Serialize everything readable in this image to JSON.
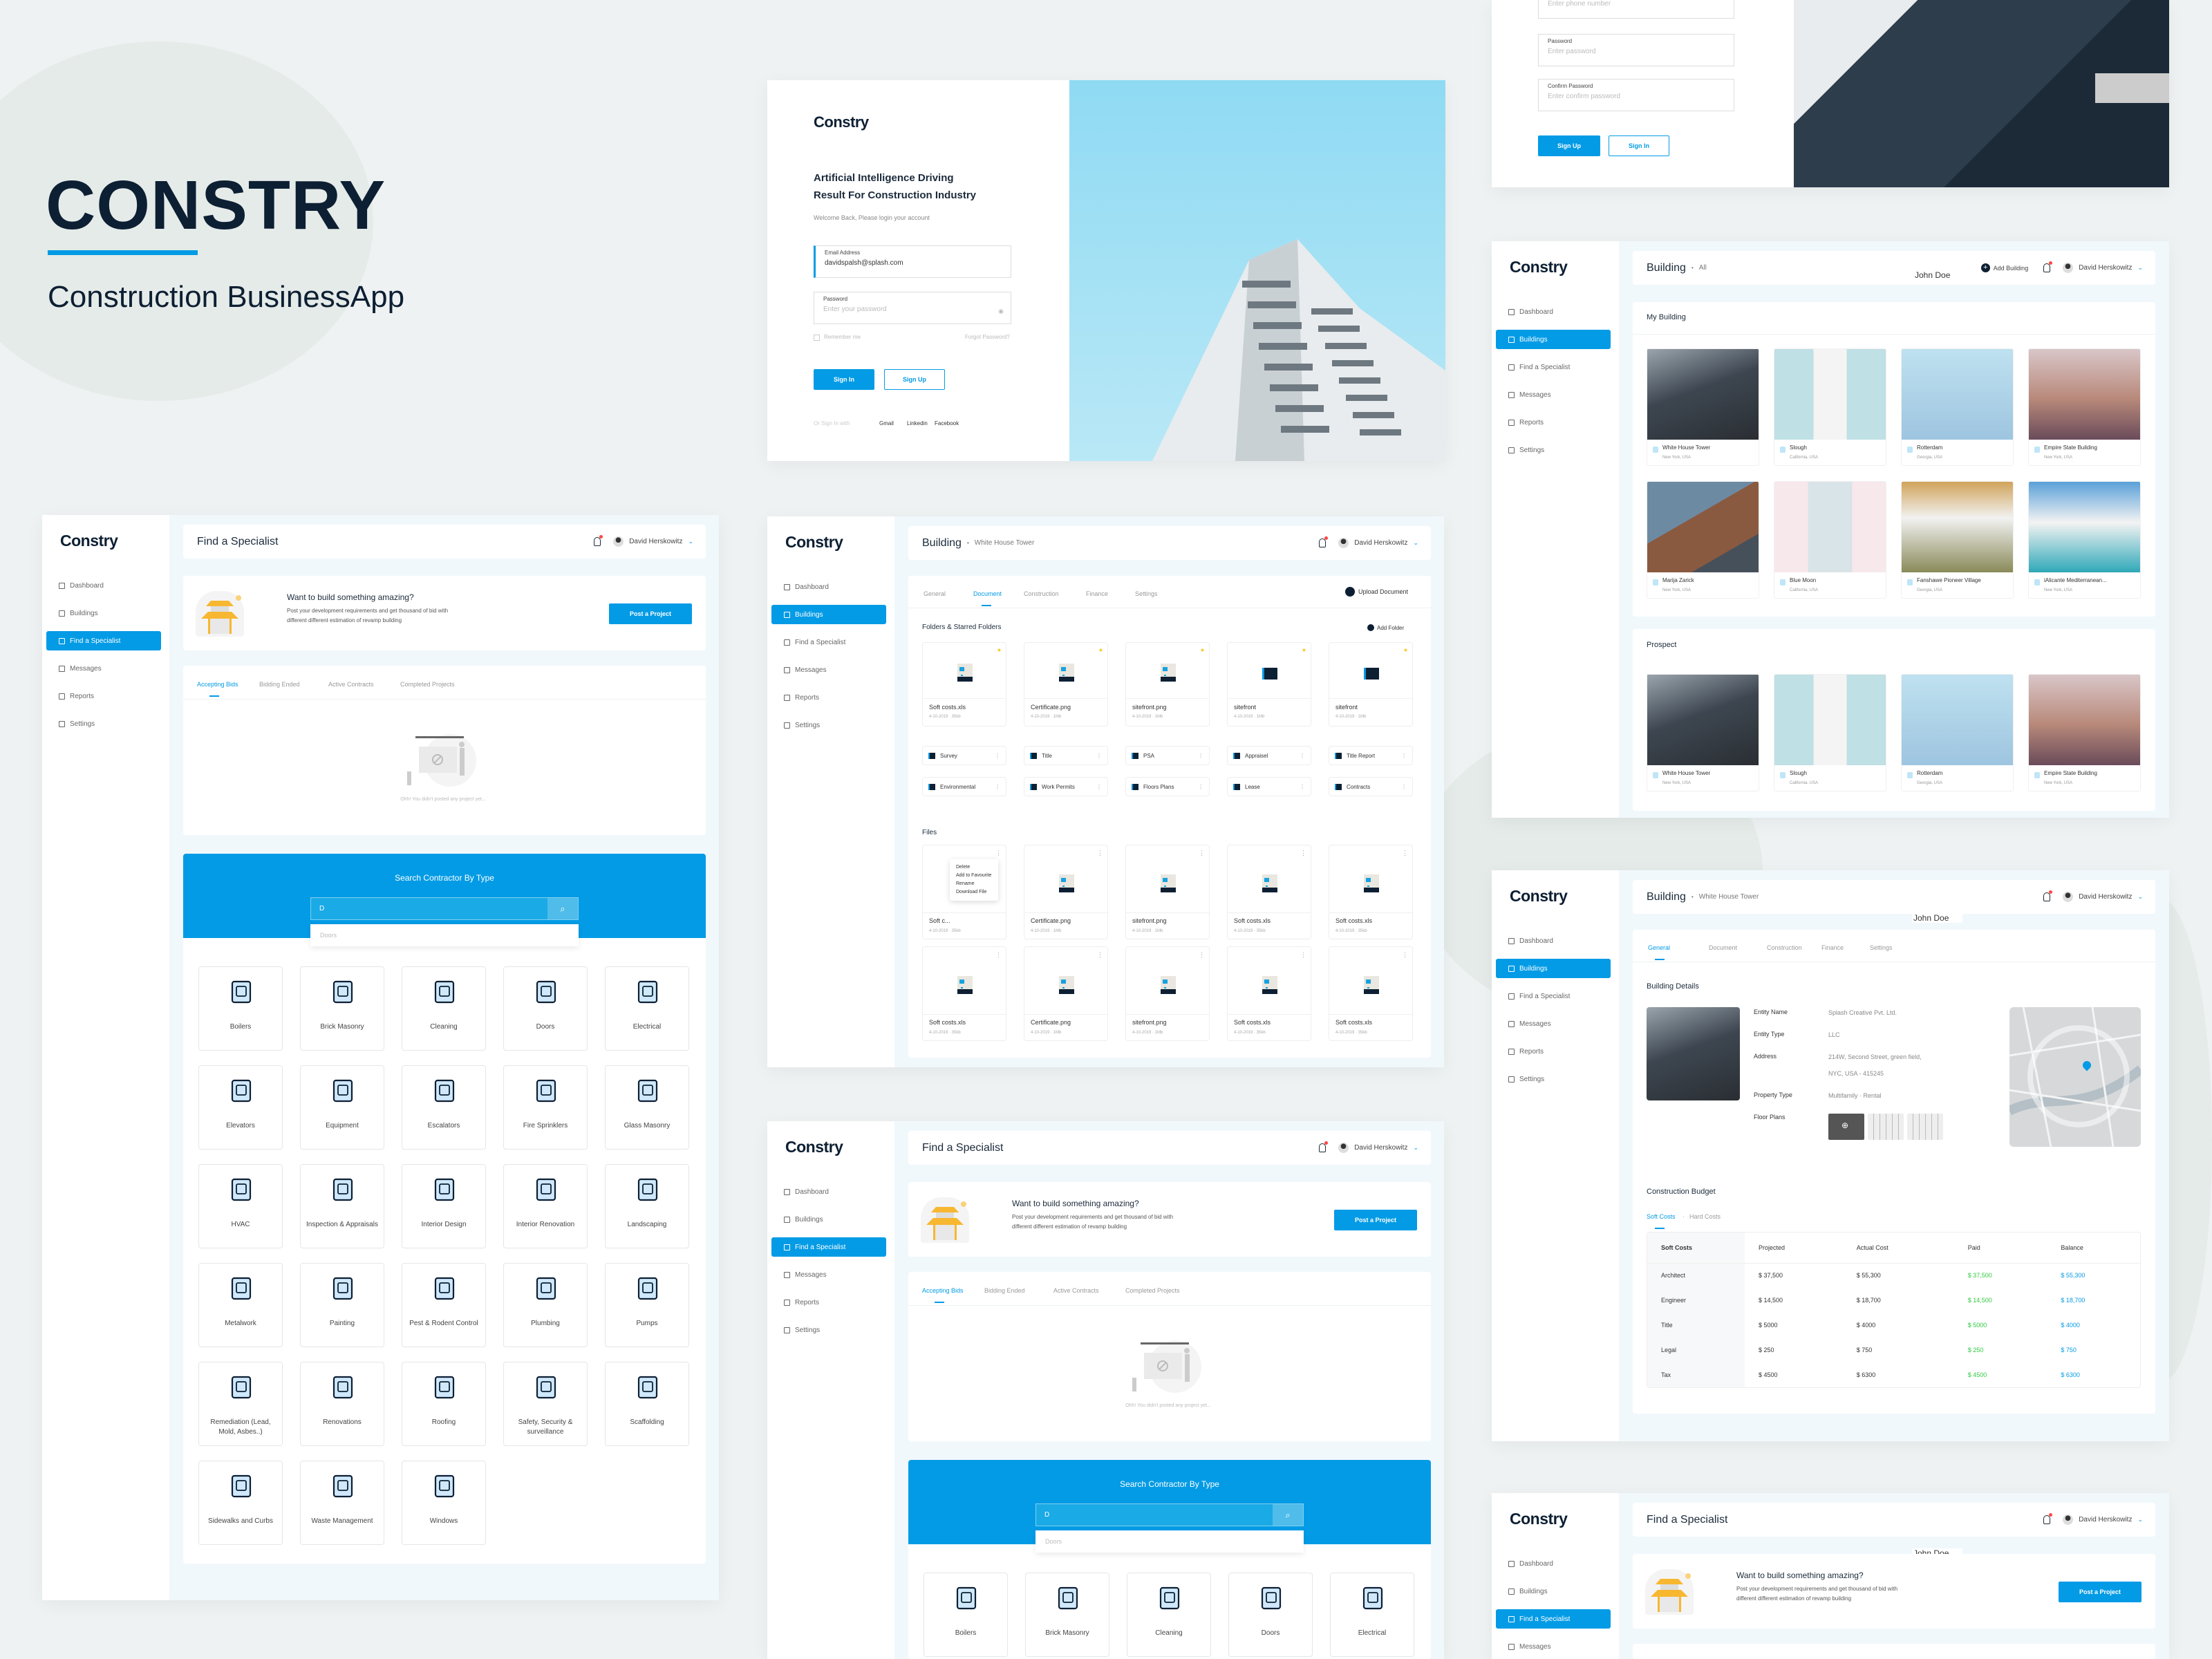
{
  "hero": {
    "title": "CONSTRY",
    "subtitle": "Construction BusinessApp"
  },
  "brand": {
    "logo": "Constry",
    "accent": "#039be5",
    "navy": "#0d1f33"
  },
  "nav": [
    {
      "label": "Dashboard",
      "icon": "dashboard-icon"
    },
    {
      "label": "Buildings",
      "icon": "building-icon"
    },
    {
      "label": "Find a Specialist",
      "icon": "specialist-icon"
    },
    {
      "label": "Messages",
      "icon": "message-icon"
    },
    {
      "label": "Reports",
      "icon": "report-icon"
    },
    {
      "label": "Settings",
      "icon": "gear-icon"
    }
  ],
  "user": {
    "name": "David Herskowitz"
  },
  "overlay_text": "John Doe",
  "login": {
    "headline_1": "Artificial Intelligence Driving",
    "headline_2": "Result For Construction Industry",
    "welcome": "Welcome Back, Please login your account",
    "email_label": "Email Address",
    "email_value": "davidspalsh@splash.com",
    "password_label": "Password",
    "password_placeholder": "Enter your password",
    "remember": "Remember me",
    "forgot": "Forgot Password?",
    "sign_in": "Sign In",
    "sign_up": "Sign Up",
    "or_sign_in_with": "Or Sign In with",
    "social": [
      "Gmail",
      "Linkedin",
      "Facebook"
    ]
  },
  "signup": {
    "phone_placeholder": "Enter phone number",
    "password_label": "Password",
    "password_placeholder": "Enter password",
    "confirm_label": "Confirm Password",
    "confirm_placeholder": "Enter confirm password",
    "sign_up": "Sign Up",
    "sign_in": "Sign In"
  },
  "buildings": {
    "title": "Building",
    "breadcrumb": "All",
    "add_building": "Add Building",
    "my_building_title": "My Building",
    "my_building": [
      {
        "name": "White House Tower",
        "location": "New York, USA"
      },
      {
        "name": "Slough",
        "location": "California, USA"
      },
      {
        "name": "Rotterdam",
        "location": "Georgia, USA"
      },
      {
        "name": "Empire State Building",
        "location": "New York, USA"
      },
      {
        "name": "Marija Zarick",
        "location": "New York, USA"
      },
      {
        "name": "Blue Moon",
        "location": "California, USA"
      },
      {
        "name": "Fanshawe Pioneer Village",
        "location": "Georgia, USA"
      },
      {
        "name": "iAlicante Mediterranean...",
        "location": "New York, USA"
      }
    ],
    "prospect_title": "Prospect",
    "prospect": [
      {
        "name": "White House Tower",
        "location": "New York, USA"
      },
      {
        "name": "Slough",
        "location": "California, USA"
      },
      {
        "name": "Rotterdam",
        "location": "Georgia, USA"
      },
      {
        "name": "Empire State Building",
        "location": "New York, USA"
      }
    ]
  },
  "building_tabs": [
    "General",
    "Document",
    "Construction",
    "Finance",
    "Settings"
  ],
  "details": {
    "title": "Building",
    "breadcrumb": "White House Tower",
    "section_title": "Building Details",
    "fields": [
      {
        "label": "Entity Name",
        "value": "Splash Creative Pvt. Ltd."
      },
      {
        "label": "Entity Type",
        "value": "LLC"
      },
      {
        "label": "Address",
        "value": "214W, Second Street, green field, NYC, USA - 415245"
      },
      {
        "label": "Property Type",
        "value": "Multifamily  ·  Rental"
      },
      {
        "label": "Floor Plans",
        "value": ""
      }
    ],
    "budget_title": "Construction Budget",
    "budget_tabs": [
      "Soft Costs",
      "Hard Costs"
    ],
    "budget_columns": [
      "Soft Costs",
      "Projected",
      "Actual Cost",
      "Paid",
      "Balance"
    ],
    "budget_rows": [
      [
        "Architect",
        "$ 37,500",
        "$ 55,300",
        "$ 37,500",
        "$ 55,300"
      ],
      [
        "Engineer",
        "$ 14,500",
        "$ 18,700",
        "$ 14,500",
        "$ 18,700"
      ],
      [
        "Title",
        "$ 5000",
        "$ 4000",
        "$ 5000",
        "$ 4000"
      ],
      [
        "Legal",
        "$ 250",
        "$ 750",
        "$ 250",
        "$ 750"
      ],
      [
        "Tax",
        "$ 4500",
        "$ 6300",
        "$ 4500",
        "$ 6300"
      ]
    ],
    "paid_color": "#2ecc40",
    "balance_color": "#039be5"
  },
  "documents": {
    "title": "Building",
    "breadcrumb": "White House Tower",
    "upload": "Upload Document",
    "folders_title": "Folders & Starred Folders",
    "add_folder": "Add Folder",
    "starred": [
      {
        "name": "Soft costs.xls",
        "meta": "4-10-2019  ·  35kb",
        "type": "file"
      },
      {
        "name": "Certificate.png",
        "meta": "4-10-2019  ·  1Mb",
        "type": "file"
      },
      {
        "name": "sitefront.png",
        "meta": "4-10-2019  ·  1Mb",
        "type": "file"
      },
      {
        "name": "sitefront",
        "meta": "4-10-2019  ·  1Mb",
        "type": "folder"
      },
      {
        "name": "sitefront",
        "meta": "4-10-2019  ·  1Mb",
        "type": "folder"
      }
    ],
    "folders": [
      "Survey",
      "Title",
      "PSA",
      "Appraisel",
      "Title Report",
      "Environmental",
      "Work Permits",
      "Floors Plans",
      "Lease",
      "Contracts"
    ],
    "files_title": "Files",
    "files": [
      {
        "name": "Soft c...",
        "meta": "4-10-2019  ·  35kb"
      },
      {
        "name": "Certificate.png",
        "meta": "4-10-2019  ·  1Mb"
      },
      {
        "name": "sitefront.png",
        "meta": "4-10-2019  ·  1Mb"
      },
      {
        "name": "Soft costs.xls",
        "meta": "4-10-2019  ·  35kb"
      },
      {
        "name": "Soft costs.xls",
        "meta": "4-10-2019  ·  35kb"
      },
      {
        "name": "Soft costs.xls",
        "meta": "4-10-2019  ·  35kb"
      },
      {
        "name": "Certificate.png",
        "meta": "4-10-2019  ·  1Mb"
      },
      {
        "name": "sitefront.png",
        "meta": "4-10-2019  ·  1Mb"
      },
      {
        "name": "Soft costs.xls",
        "meta": "4-10-2019  ·  35kb"
      },
      {
        "name": "Soft costs.xls",
        "meta": "4-10-2019  ·  35kb"
      }
    ],
    "context_menu": [
      "Delete",
      "Add to Favourite",
      "Rename",
      "Download File"
    ]
  },
  "specialist": {
    "title": "Find a Specialist",
    "banner_heading": "Want to build something amazing?",
    "banner_text_1": "Post your development requirements and get thousand of bid with",
    "banner_text_2": "different different estimation of revamp building",
    "post_button": "Post a Project",
    "tabs": [
      "Accepting Bids",
      "Bidding Ended",
      "Active Contracts",
      "Completed Projects"
    ],
    "empty_text": "Ohh! You didn't posted any project yet...",
    "search_title": "Search Contractor By Type",
    "search_value": "D",
    "suggestion": "Doors",
    "categories": [
      {
        "label": "Boilers",
        "icon": "boiler-icon"
      },
      {
        "label": "Brick Masonry",
        "icon": "brick-icon"
      },
      {
        "label": "Cleaning",
        "icon": "cleaning-icon"
      },
      {
        "label": "Doors",
        "icon": "door-icon"
      },
      {
        "label": "Electrical",
        "icon": "bulb-icon"
      },
      {
        "label": "Elevators",
        "icon": "elevator-icon"
      },
      {
        "label": "Equipment",
        "icon": "equipment-icon"
      },
      {
        "label": "Escalators",
        "icon": "escalator-icon"
      },
      {
        "label": "Fire Sprinklers",
        "icon": "sprinkler-icon"
      },
      {
        "label": "Glass Masonry",
        "icon": "glass-icon"
      },
      {
        "label": "HVAC",
        "icon": "hvac-icon"
      },
      {
        "label": "Inspection & Appraisals",
        "icon": "inspection-icon"
      },
      {
        "label": "Interior Design",
        "icon": "curtain-icon"
      },
      {
        "label": "Interior Renovation",
        "icon": "house-plug-icon"
      },
      {
        "label": "Landscaping",
        "icon": "shears-icon"
      },
      {
        "label": "Metalwork",
        "icon": "anvil-icon"
      },
      {
        "label": "Painting",
        "icon": "brush-icon"
      },
      {
        "label": "Pest & Rodent Control",
        "icon": "pest-icon"
      },
      {
        "label": "Plumbing",
        "icon": "faucet-icon"
      },
      {
        "label": "Pumps",
        "icon": "pump-icon"
      },
      {
        "label": "Remediation (Lead, Mold, Asbes..)",
        "icon": "hazard-icon"
      },
      {
        "label": "Renovations",
        "icon": "renovation-icon"
      },
      {
        "label": "Roofing",
        "icon": "roof-icon"
      },
      {
        "label": "Safety, Security & surveillance",
        "icon": "camera-icon"
      },
      {
        "label": "Scaffolding",
        "icon": "scaffold-icon"
      },
      {
        "label": "Sidewalks and Curbs",
        "icon": "footprints-icon"
      },
      {
        "label": "Waste Management",
        "icon": "truck-icon"
      },
      {
        "label": "Windows",
        "icon": "window-icon"
      }
    ]
  }
}
